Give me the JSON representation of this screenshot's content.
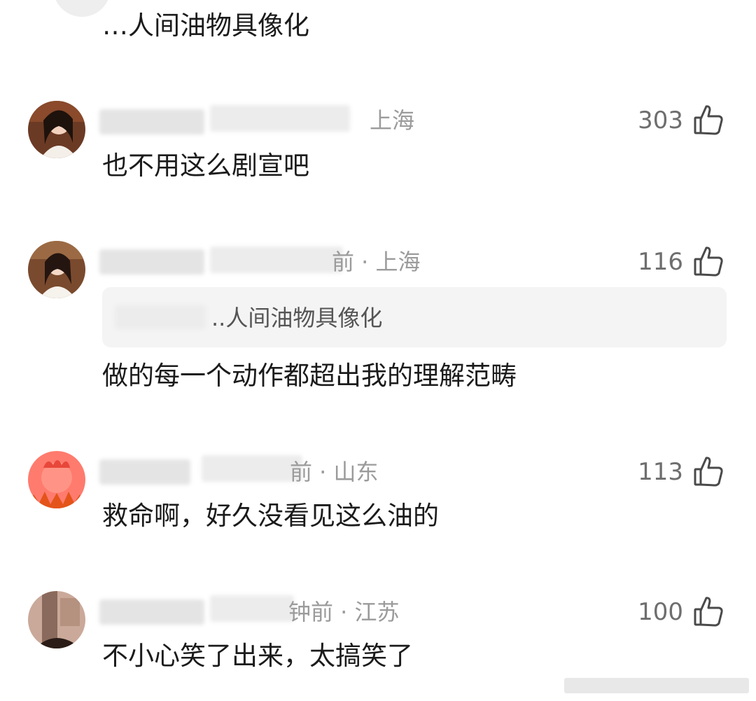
{
  "top": {
    "text": "…人间油物具像化"
  },
  "comments": [
    {
      "meta": "上海",
      "likes": "303",
      "text": "也不用这么剧宣吧"
    },
    {
      "meta": "前 · 上海",
      "likes": "116",
      "quote": "..人间油物具像化",
      "text": "做的每一个动作都超出我的理解范畴"
    },
    {
      "meta": "前 · 山东",
      "likes": "113",
      "text": "救命啊，好久没看见这么油的"
    },
    {
      "meta": "钟前 · 江苏",
      "likes": "100",
      "text": "不小心笑了出来，太搞笑了"
    }
  ]
}
